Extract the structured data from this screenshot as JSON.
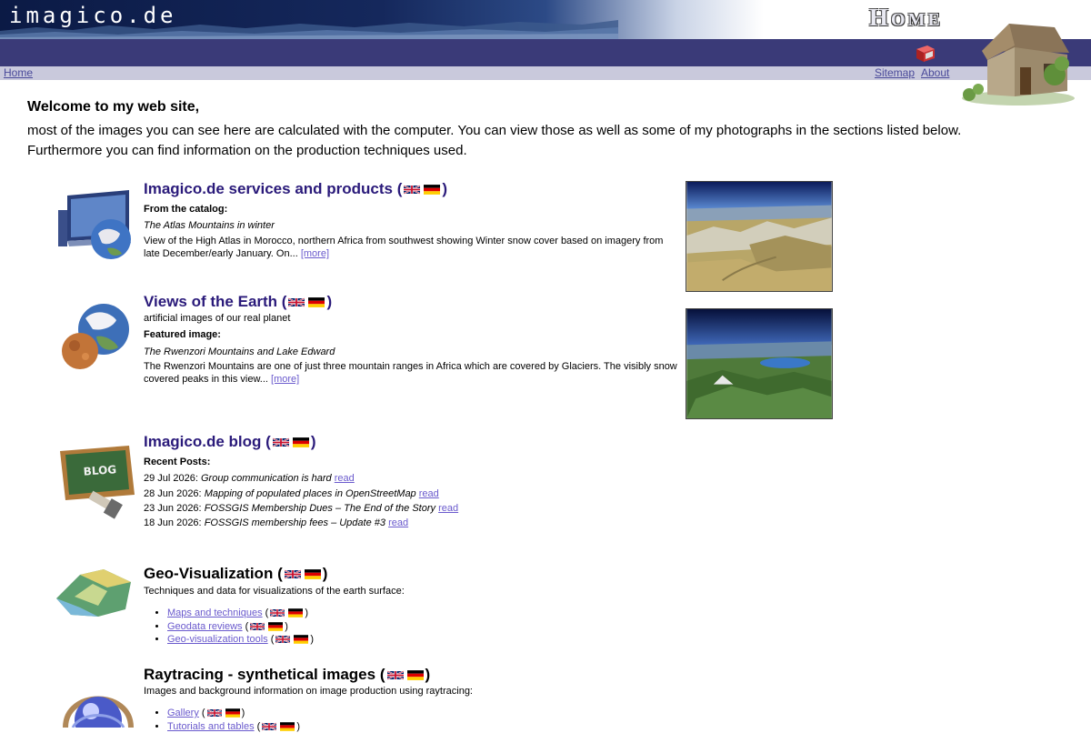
{
  "header": {
    "site_name": "imagico.de",
    "page_title_first": "H",
    "page_title_rest": "OME",
    "nav_left": "Home",
    "nav_sitemap": "Sitemap",
    "nav_about": "About"
  },
  "intro": {
    "welcome": "Welcome to my web site,",
    "text": "most of the images you can see here are calculated with the computer. You can view those as well as some of my photographs in the sections listed below. Furthermore you can find information on the production techniques used."
  },
  "sections": {
    "services": {
      "title": "Imagico.de services and products",
      "catalog_label": "From the catalog:",
      "item_title": "The Atlas Mountains in winter",
      "item_desc": "View of the High Atlas in Morocco, northern Africa from southwest showing Winter snow cover based on imagery from late December/early January. On...",
      "more": "[more]"
    },
    "earth": {
      "title": "Views of the Earth",
      "subtitle": "artificial images of our real planet",
      "featured_label": "Featured image:",
      "item_title": "The Rwenzori Mountains and Lake Edward",
      "item_desc": "The Rwenzori Mountains are one of just three mountain ranges in Africa which are covered by Glaciers. The visibly snow covered peaks in this view...",
      "more": "[more]"
    },
    "blog": {
      "title": "Imagico.de blog",
      "recent_label": "Recent Posts:",
      "read_label": "read",
      "posts": [
        {
          "date": "29 Jul 2026:",
          "title": "Group communication is hard"
        },
        {
          "date": "28 Jun 2026:",
          "title": "Mapping of populated places in OpenStreetMap"
        },
        {
          "date": "23 Jun 2026:",
          "title": "FOSSGIS Membership Dues – The End of the Story"
        },
        {
          "date": "18 Jun 2026:",
          "title": "FOSSGIS membership fees – Update #3"
        }
      ]
    },
    "geovis": {
      "title": "Geo-Visualization",
      "subtitle": "Techniques and data for visualizations of the earth surface:",
      "links": [
        "Maps and techniques",
        "Geodata reviews",
        "Geo-visualization tools"
      ]
    },
    "raytracing": {
      "title": "Raytracing - synthetical images",
      "subtitle": "Images and background information on image production using raytracing:",
      "links": [
        "Gallery",
        "Tutorials and tables"
      ]
    }
  },
  "punct": {
    "open": "(",
    "close": ")"
  },
  "colors": {
    "title_link": "#2a1a7a",
    "link": "#6a5acd",
    "nav_band": "#3a3a78",
    "nav_light": "#c9c9dc"
  },
  "icons": {
    "english_flag": "uk-flag-icon",
    "german_flag": "de-flag-icon"
  }
}
